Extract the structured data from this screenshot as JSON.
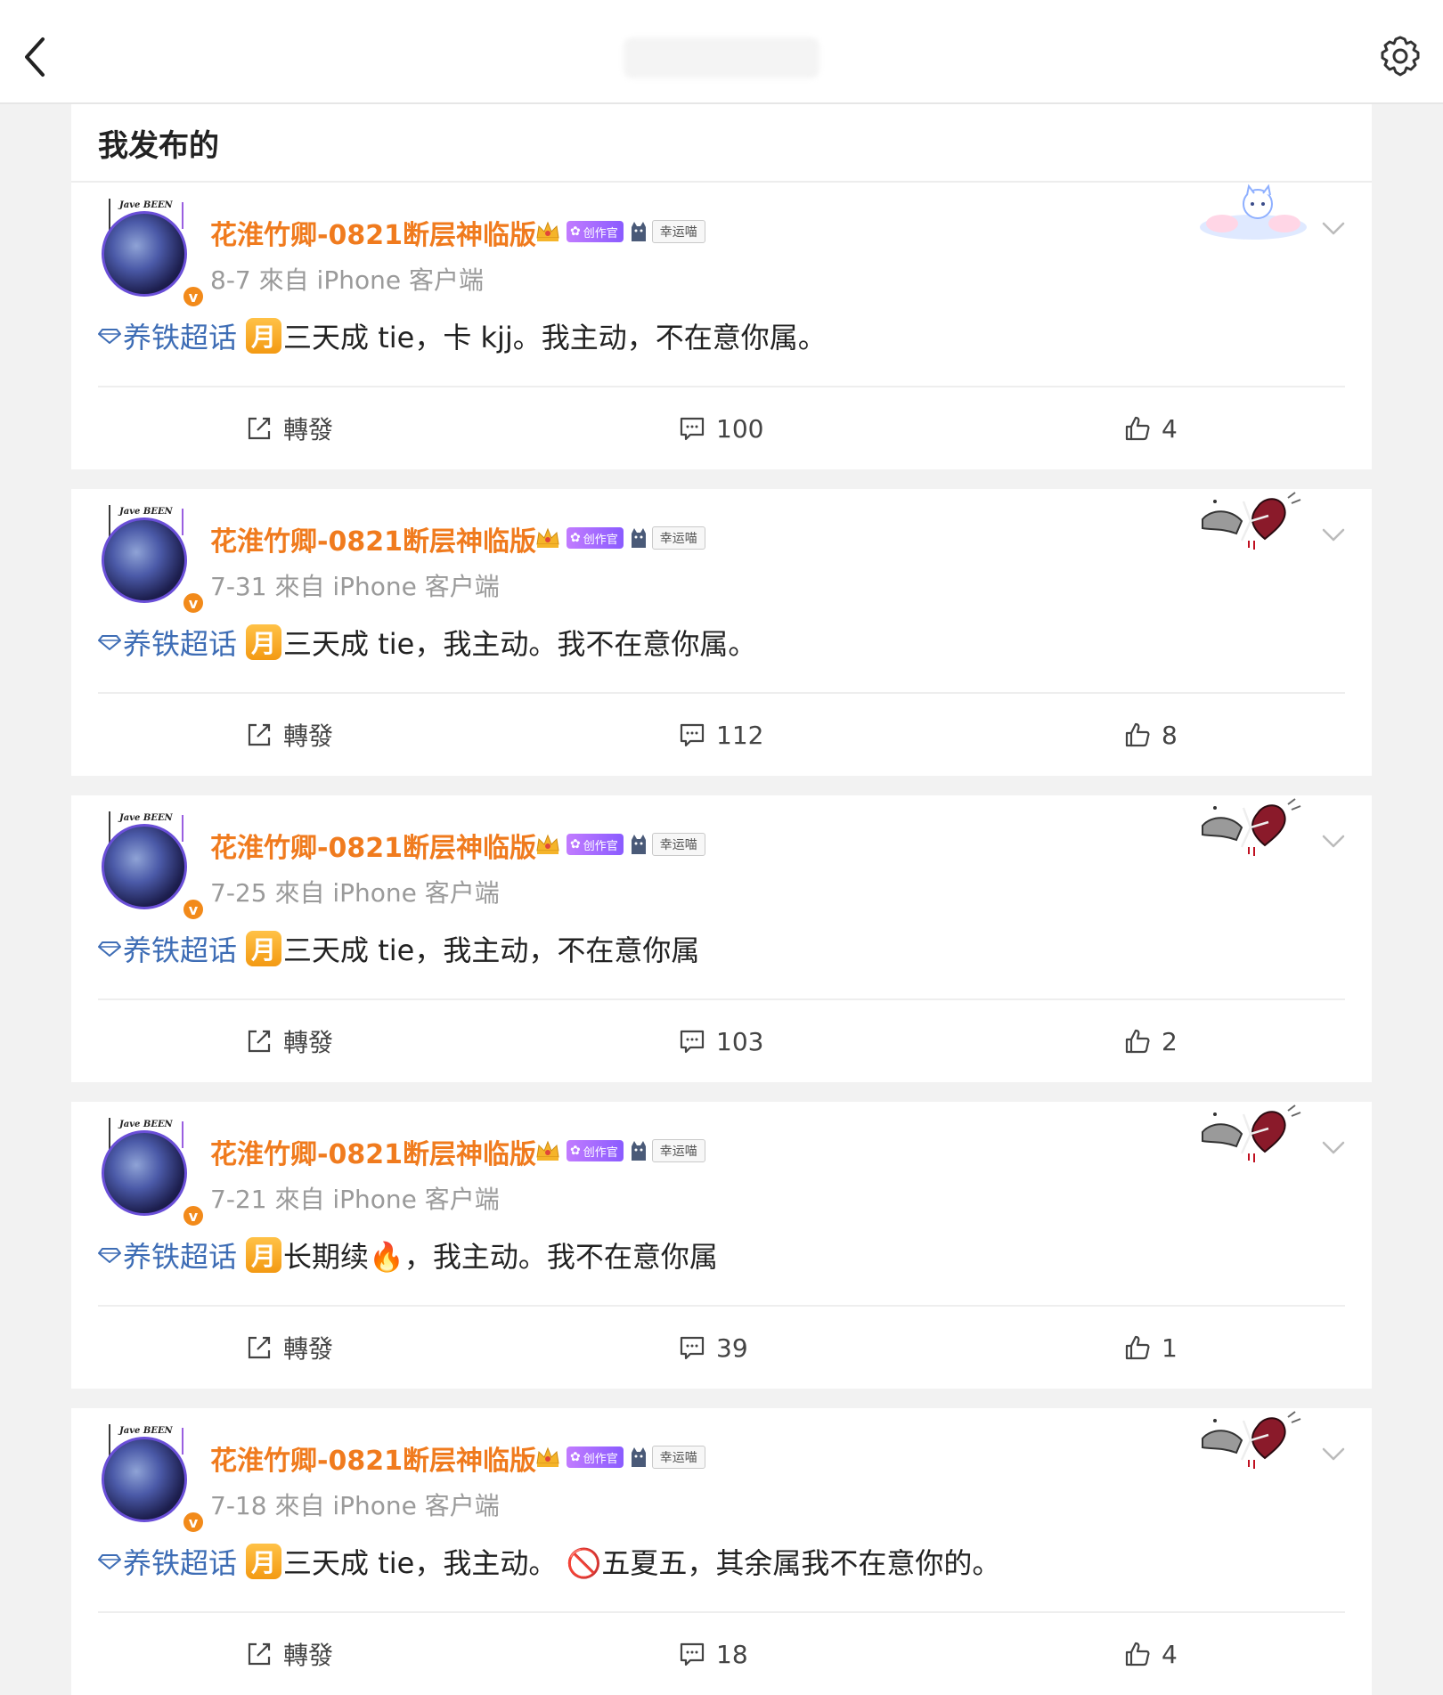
{
  "header": {
    "back_icon": "chevron-left-icon",
    "settings_icon": "gear-icon"
  },
  "section": {
    "title": "我发布的"
  },
  "posts": [
    {
      "username": "花淮竹卿-0821断层神临版",
      "creator_badge": "创作官",
      "lucky_badge": "幸运喵",
      "meta": "8-7  來自 iPhone 客户端",
      "topic": "养铁超话",
      "month_badge": "月",
      "text": "三天成 tie，卡 kjj。我主动，不在意你属。",
      "repost_label": "轉發",
      "comments": "100",
      "likes": "4",
      "decoration": "cloud-cat"
    },
    {
      "username": "花淮竹卿-0821断层神临版",
      "creator_badge": "创作官",
      "lucky_badge": "幸运喵",
      "meta": "7-31  來自 iPhone 客户端",
      "topic": "养铁超话",
      "month_badge": "月",
      "text": "三天成 tie，我主动。我不在意你属。",
      "repost_label": "轉發",
      "comments": "112",
      "likes": "8",
      "decoration": "dark-heart"
    },
    {
      "username": "花淮竹卿-0821断层神临版",
      "creator_badge": "创作官",
      "lucky_badge": "幸运喵",
      "meta": "7-25  來自 iPhone 客户端",
      "topic": "养铁超话",
      "month_badge": "月",
      "text": "三天成 tie，我主动，不在意你属",
      "repost_label": "轉發",
      "comments": "103",
      "likes": "2",
      "decoration": "dark-heart"
    },
    {
      "username": "花淮竹卿-0821断层神临版",
      "creator_badge": "创作官",
      "lucky_badge": "幸运喵",
      "meta": "7-21  來自 iPhone 客户端",
      "topic": "养铁超话",
      "month_badge": "月",
      "text": "长期续🔥，我主动。我不在意你属",
      "repost_label": "轉發",
      "comments": "39",
      "likes": "1",
      "decoration": "dark-heart"
    },
    {
      "username": "花淮竹卿-0821断层神临版",
      "creator_badge": "创作官",
      "lucky_badge": "幸运喵",
      "meta": "7-18  來自 iPhone 客户端",
      "topic": "养铁超话",
      "month_badge": "月",
      "text": "三天成 tie，我主动。 🚫五夏五，其余属我不在意你的。",
      "repost_label": "轉發",
      "comments": "18",
      "likes": "4",
      "decoration": "dark-heart"
    }
  ],
  "colors": {
    "username": "#f07b1e",
    "topic": "#3e6db5",
    "month_badge": "#f6a623",
    "background": "#f2f2f2"
  }
}
